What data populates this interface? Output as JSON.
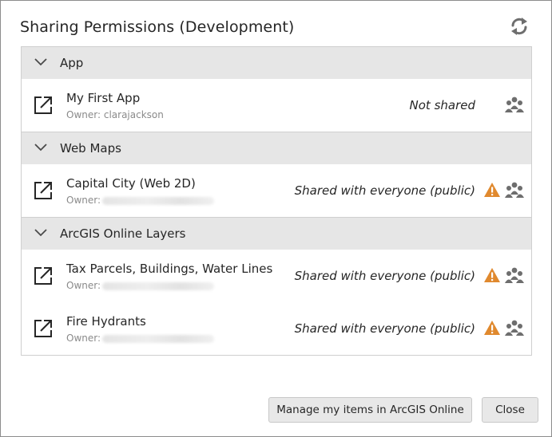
{
  "dialog": {
    "title": "Sharing Permissions (Development)",
    "refresh_icon": "refresh-icon"
  },
  "groups": [
    {
      "label": "App",
      "items": [
        {
          "name": "My First  App",
          "owner_label": "Owner:",
          "owner": "clarajackson",
          "status": "Not shared",
          "warning": false
        }
      ]
    },
    {
      "label": "Web Maps",
      "items": [
        {
          "name": "Capital City (Web 2D)",
          "owner_label": "Owner:",
          "status": "Shared with everyone (public)",
          "warning": true
        }
      ]
    },
    {
      "label": "ArcGIS Online Layers",
      "items": [
        {
          "name": "Tax Parcels, Buildings, Water Lines",
          "owner_label": "Owner:",
          "status": "Shared with everyone (public)",
          "warning": true
        },
        {
          "name": "Fire Hydrants",
          "owner_label": "Owner:",
          "status": "Shared with everyone (public)",
          "warning": true
        }
      ]
    }
  ],
  "buttons": {
    "manage": "Manage my items in ArcGIS Online",
    "close": "Close"
  },
  "icons": {
    "open": "open-external-icon",
    "warning": "warning-icon",
    "group": "group-icon",
    "chevron": "chevron-down-icon"
  },
  "colors": {
    "header_bg": "#e6e6e6",
    "warning": "#e0892e",
    "icon_gray": "#6e6e6e"
  }
}
